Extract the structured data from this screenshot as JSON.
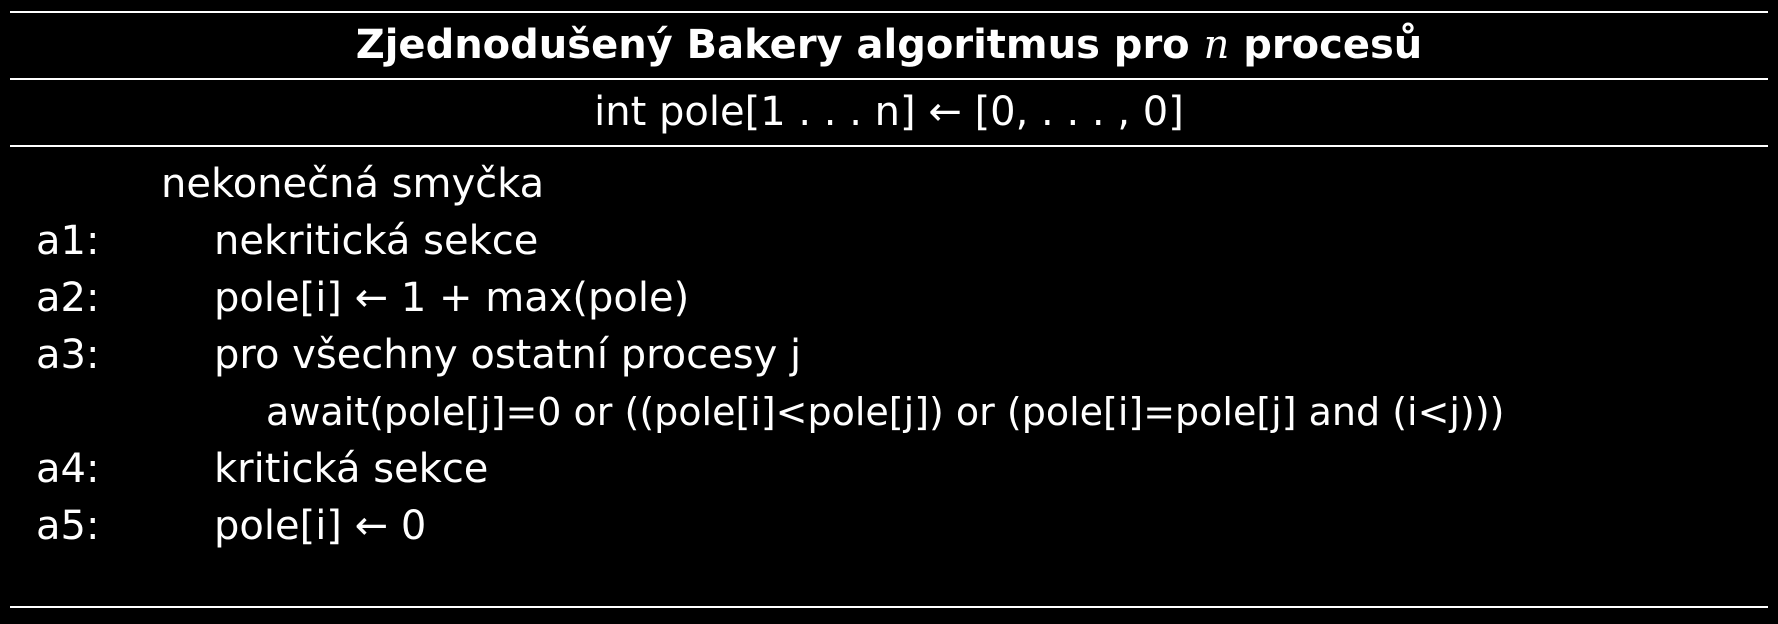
{
  "header": {
    "title_prefix": "Zjednodušený Bakery algoritmus pro",
    "title_var": "n",
    "title_suffix": "procesů"
  },
  "declaration": "int pole[1 . . . n] ← [0, . . . , 0]",
  "lines": [
    {
      "label": "",
      "text": "nekonečná smyčka"
    },
    {
      "label": "a1:",
      "text": "nekritická sekce"
    },
    {
      "label": "a2:",
      "text": "pole[i] ← 1 + max(pole)"
    },
    {
      "label": "a3:",
      "text": "pro všechny ostatní procesy j"
    },
    {
      "label": "",
      "text": "await(pole[j]=0 or ((pole[i]<pole[j]) or (pole[i]=pole[j] and (i<j)))"
    },
    {
      "label": "a4:",
      "text": "kritická sekce"
    },
    {
      "label": "a5:",
      "text": "pole[i] ← 0"
    }
  ]
}
